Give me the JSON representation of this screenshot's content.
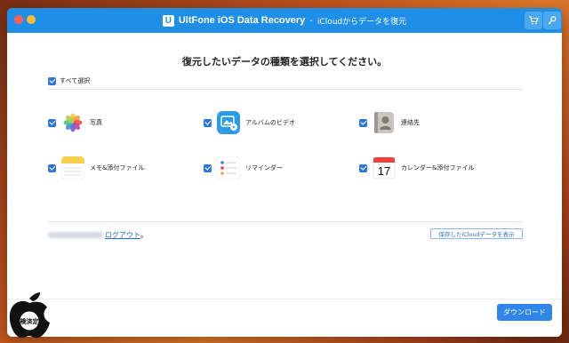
{
  "window": {
    "app_badge": "U",
    "title": "UltFone iOS Data Recovery",
    "separator": "-",
    "subtitle": "iCloudからデータを復元"
  },
  "toolbar": {
    "cart_icon": "cart-icon",
    "key_icon": "key-icon"
  },
  "heading": "復元したいデータの種類を選択してください。",
  "select_all": {
    "label": "すべて選択",
    "checked": true
  },
  "categories": [
    {
      "label": "写真",
      "icon": "photos-icon",
      "checked": true
    },
    {
      "label": "アルバムのビデオ",
      "icon": "album-video-icon",
      "checked": true
    },
    {
      "label": "連絡先",
      "icon": "contacts-icon",
      "checked": true
    },
    {
      "label": "メモ&添付ファイル",
      "icon": "notes-icon",
      "checked": true
    },
    {
      "label": "リマインダー",
      "icon": "reminders-icon",
      "checked": true
    },
    {
      "label": "カレンダー&添付ファイル",
      "icon": "calendar-icon",
      "checked": true,
      "calendar_day": "17"
    }
  ],
  "account": {
    "logout_label": "ログアウト",
    "suffix": "。"
  },
  "view_saved_button": "保存したiCloudデータを表示",
  "download_button": "ダウンロード",
  "watermark": {
    "text": "検済定"
  },
  "colors": {
    "titlebar": "#1f8ee6",
    "accent": "#2f86e8",
    "checkbox": "#2b77d8"
  }
}
